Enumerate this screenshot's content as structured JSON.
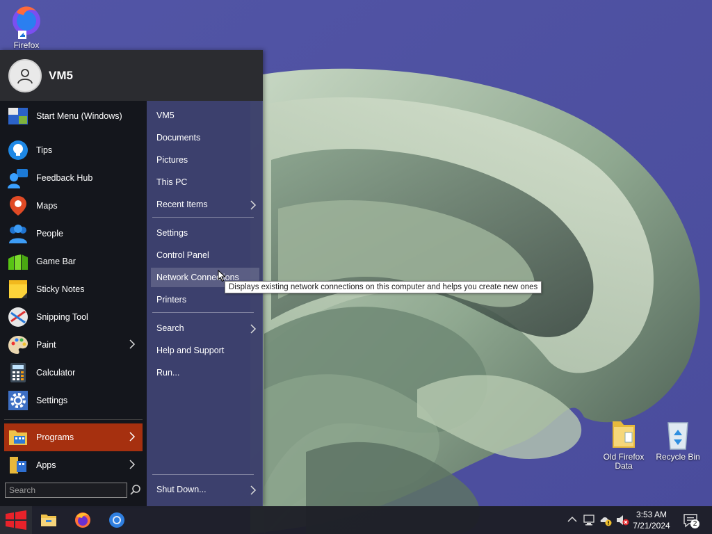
{
  "desktop": {
    "icons": [
      {
        "label": "Firefox"
      },
      {
        "label": "Old Firefox Data"
      },
      {
        "label": "Recycle Bin"
      }
    ]
  },
  "start_menu": {
    "user": "VM5",
    "left_items": [
      {
        "label": "Start Menu (Windows)",
        "icon": "start-menu-icon"
      },
      {
        "label": "Tips",
        "icon": "lightbulb-icon"
      },
      {
        "label": "Feedback Hub",
        "icon": "feedback-icon"
      },
      {
        "label": "Maps",
        "icon": "map-pin-icon"
      },
      {
        "label": "People",
        "icon": "people-icon"
      },
      {
        "label": "Game Bar",
        "icon": "game-bar-icon"
      },
      {
        "label": "Sticky Notes",
        "icon": "sticky-note-icon"
      },
      {
        "label": "Snipping Tool",
        "icon": "scissors-icon"
      },
      {
        "label": "Paint",
        "icon": "palette-icon",
        "submenu": true
      },
      {
        "label": "Calculator",
        "icon": "calculator-icon"
      },
      {
        "label": "Settings",
        "icon": "gear-icon"
      }
    ],
    "programs": {
      "label": "Programs",
      "active": true
    },
    "apps": {
      "label": "Apps"
    },
    "search": {
      "placeholder": "Search"
    },
    "right_items": [
      {
        "label": "VM5"
      },
      {
        "label": "Documents"
      },
      {
        "label": "Pictures"
      },
      {
        "label": "This PC"
      },
      {
        "label": "Recent Items",
        "submenu": true
      },
      {
        "label": "Settings"
      },
      {
        "label": "Control Panel"
      },
      {
        "label": "Network Connections",
        "hover": true
      },
      {
        "label": "Printers"
      },
      {
        "label": "Search",
        "submenu": true
      },
      {
        "label": "Help and Support"
      },
      {
        "label": "Run..."
      }
    ],
    "shutdown": {
      "label": "Shut Down..."
    }
  },
  "tooltip": {
    "text": "Displays existing network connections on this computer and helps you create new ones"
  },
  "taskbar": {
    "time": "3:53 AM",
    "date": "7/21/2024",
    "notification_count": "2",
    "accent_color": "#a6300f"
  }
}
